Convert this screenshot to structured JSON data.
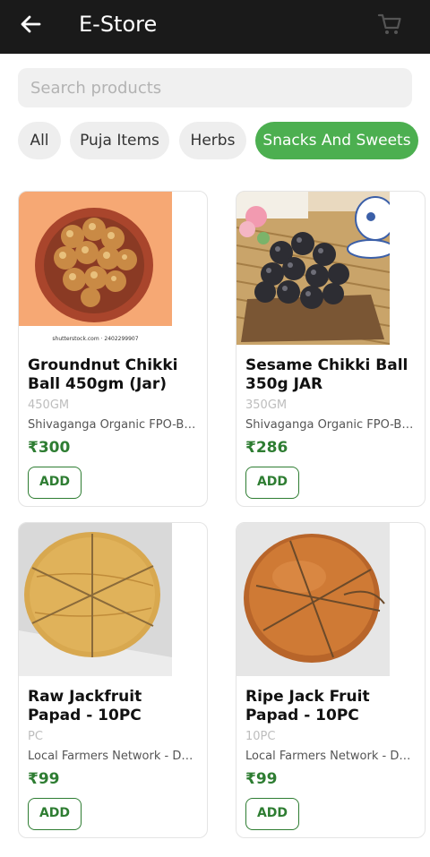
{
  "header": {
    "title": "E-Store",
    "back_icon": "arrow-left-icon",
    "cart_icon": "shopping-cart-icon"
  },
  "search": {
    "placeholder": "Search products",
    "value": ""
  },
  "categories": [
    {
      "label": "All",
      "active": false
    },
    {
      "label": "Puja Items",
      "active": false
    },
    {
      "label": "Herbs",
      "active": false
    },
    {
      "label": "Snacks And Sweets",
      "active": true
    }
  ],
  "products": [
    {
      "name": "Groundnut Chikki Ball 450gm (Jar)",
      "unit": "450GM",
      "seller": "Shivaganga Organic FPO-Bangalore",
      "price": "₹300",
      "add_label": "ADD",
      "image_caption": "shutterstock.com · 2402299907"
    },
    {
      "name": "Sesame Chikki Ball 350g JAR",
      "unit": "350GM",
      "seller": "Shivaganga Organic FPO-Bangalore",
      "price": "₹286",
      "add_label": "ADD"
    },
    {
      "name": "Raw Jackfruit Papad - 10PC",
      "unit": "PC",
      "seller": "Local Farmers Network - Dakshina Kannada",
      "price": "₹99",
      "add_label": "ADD"
    },
    {
      "name": "Ripe Jack Fruit Papad - 10PC",
      "unit": "10PC",
      "seller": "Local Farmers Network - Dakshina Kannada",
      "price": "₹99",
      "add_label": "ADD"
    }
  ],
  "colors": {
    "appbar": "#1a1a1a",
    "accent": "#4caf50",
    "price": "#2e7d32"
  }
}
